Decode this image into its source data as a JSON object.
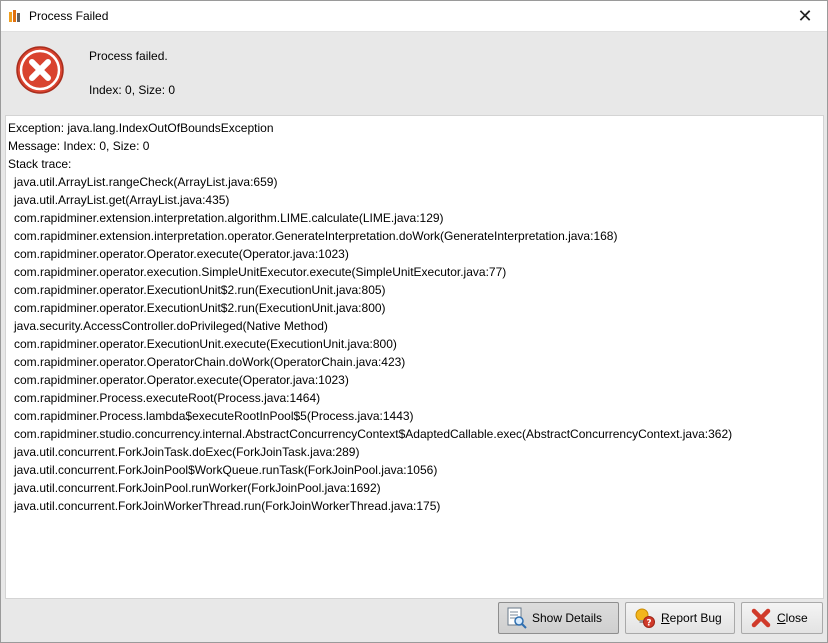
{
  "window": {
    "title": "Process Failed",
    "close_glyph": "✕"
  },
  "header": {
    "message": "Process failed.",
    "detail": "Index: 0, Size: 0",
    "icon": "error-icon"
  },
  "trace": {
    "exception": "Exception: java.lang.IndexOutOfBoundsException",
    "message": "Message: Index: 0, Size: 0",
    "stack_label": "Stack trace:",
    "frames": [
      "java.util.ArrayList.rangeCheck(ArrayList.java:659)",
      "java.util.ArrayList.get(ArrayList.java:435)",
      "com.rapidminer.extension.interpretation.algorithm.LIME.calculate(LIME.java:129)",
      "com.rapidminer.extension.interpretation.operator.GenerateInterpretation.doWork(GenerateInterpretation.java:168)",
      "com.rapidminer.operator.Operator.execute(Operator.java:1023)",
      "com.rapidminer.operator.execution.SimpleUnitExecutor.execute(SimpleUnitExecutor.java:77)",
      "com.rapidminer.operator.ExecutionUnit$2.run(ExecutionUnit.java:805)",
      "com.rapidminer.operator.ExecutionUnit$2.run(ExecutionUnit.java:800)",
      "java.security.AccessController.doPrivileged(Native Method)",
      "com.rapidminer.operator.ExecutionUnit.execute(ExecutionUnit.java:800)",
      "com.rapidminer.operator.OperatorChain.doWork(OperatorChain.java:423)",
      "com.rapidminer.operator.Operator.execute(Operator.java:1023)",
      "com.rapidminer.Process.executeRoot(Process.java:1464)",
      "com.rapidminer.Process.lambda$executeRootInPool$5(Process.java:1443)",
      "com.rapidminer.studio.concurrency.internal.AbstractConcurrencyContext$AdaptedCallable.exec(AbstractConcurrencyContext.java:362)",
      "java.util.concurrent.ForkJoinTask.doExec(ForkJoinTask.java:289)",
      "java.util.concurrent.ForkJoinPool$WorkQueue.runTask(ForkJoinPool.java:1056)",
      "java.util.concurrent.ForkJoinPool.runWorker(ForkJoinPool.java:1692)",
      "java.util.concurrent.ForkJoinWorkerThread.run(ForkJoinWorkerThread.java:175)"
    ]
  },
  "buttons": {
    "show_details": {
      "label": "Show Details",
      "icon": "document-search-icon"
    },
    "report_bug": {
      "label": "Report Bug",
      "mnemonic": "R",
      "rest": "eport Bug",
      "icon": "bug-report-icon"
    },
    "close": {
      "label": "Close",
      "mnemonic": "C",
      "rest": "lose",
      "icon": "close-icon"
    }
  },
  "colors": {
    "error_red": "#d9432f",
    "close_red": "#d03a2a",
    "bulb_yellow": "#f2b51c"
  }
}
